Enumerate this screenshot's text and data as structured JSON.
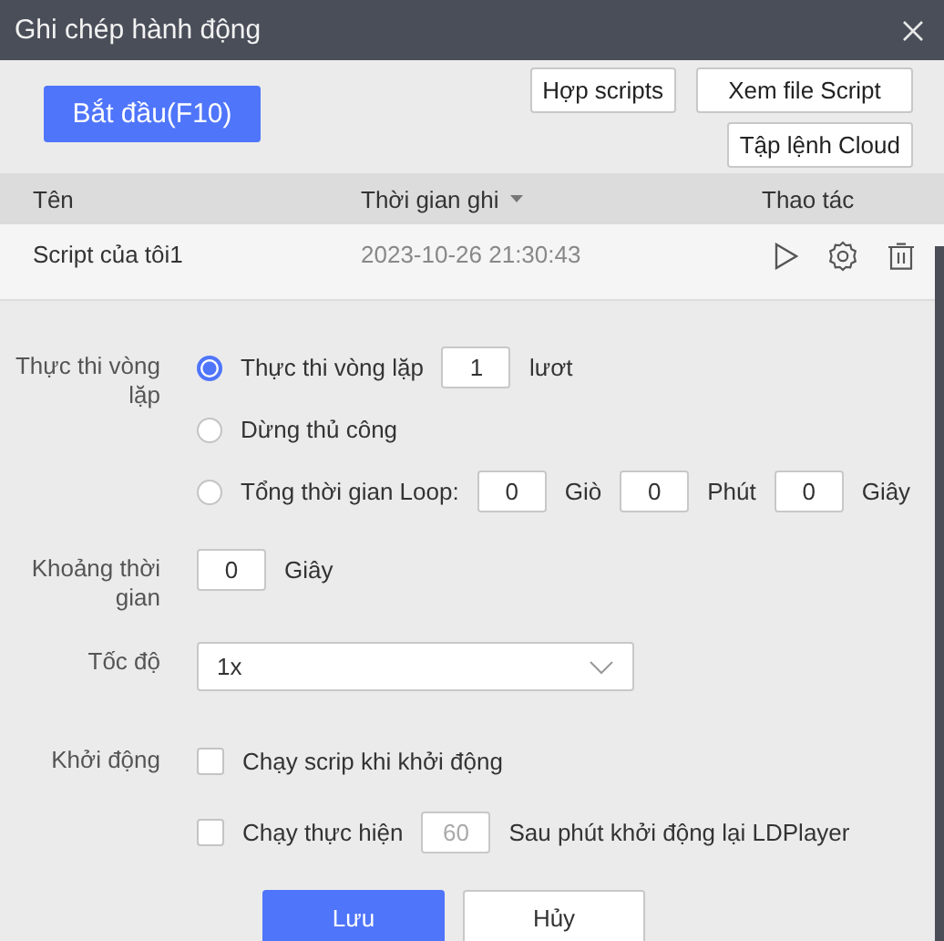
{
  "window": {
    "title": "Ghi chép hành động"
  },
  "toolbar": {
    "start_button": "Bắt đầu(F10)",
    "buttons": [
      "Hợp scripts",
      "Xem file Script",
      "Tập lệnh Cloud"
    ]
  },
  "table": {
    "columns": [
      {
        "label": "Tên",
        "sorted": false
      },
      {
        "label": "Thời gian ghi",
        "sorted": true
      },
      {
        "label": "Thao tác",
        "sorted": false
      }
    ],
    "rows": [
      {
        "name": "Script của tôi1",
        "time": "2023-10-26 21:30:43"
      }
    ]
  },
  "loop": {
    "label": "Thực thi vòng lặp",
    "options": [
      {
        "kind": "count",
        "label": "Thực thi vòng lặp",
        "selected": true,
        "value": "1",
        "unit": "lươt"
      },
      {
        "kind": "plain",
        "label": "Dừng thủ công",
        "selected": false
      },
      {
        "kind": "duration",
        "label": "Tổng thời gian Loop:",
        "selected": false,
        "fields": [
          {
            "value": "0",
            "unit": "Giò"
          },
          {
            "value": "0",
            "unit": "Phút"
          },
          {
            "value": "0",
            "unit": "Giây"
          }
        ]
      }
    ]
  },
  "interval": {
    "label": "Khoảng thời gian",
    "value": "0",
    "unit": "Giây"
  },
  "speed": {
    "label": "Tốc độ",
    "value": "1x"
  },
  "startup": {
    "label": "Khởi động",
    "options": [
      {
        "kind": "plain",
        "label": "Chạy scrip khi khởi động",
        "checked": false
      },
      {
        "kind": "delay",
        "label": "Chạy thực hiện",
        "checked": false,
        "placeholder": "60",
        "suffix": "Sau phút khởi động lại LDPlayer"
      }
    ]
  },
  "buttons": {
    "save": "Lưu",
    "cancel": "Hủy"
  }
}
